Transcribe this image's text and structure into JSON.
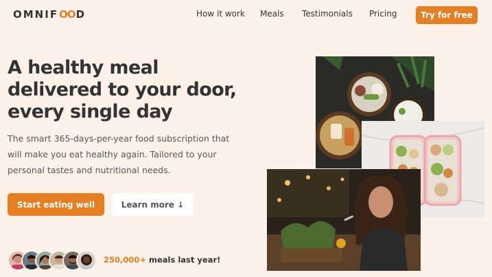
{
  "header": {
    "logo": {
      "prefix": "OMNIF",
      "oo": "OO",
      "suffix": "D"
    },
    "nav": [
      {
        "label": "How it work"
      },
      {
        "label": "Meals"
      },
      {
        "label": "Testimonials"
      },
      {
        "label": "Pricing"
      }
    ],
    "cta_label": "Try for free"
  },
  "hero": {
    "title_lines": [
      "A healthy meal",
      "delivered to your door,",
      "every single day"
    ],
    "description_lines": [
      "The smart 365-days-per-year food subscription that",
      "will make you eat healthy again. Tailored to your",
      "personal tastes and nutritional needs."
    ],
    "primary_button": "Start eating well",
    "secondary_button": "Learn more ↓"
  },
  "delivered": {
    "number": "250,000+",
    "text": " meals last year!"
  },
  "colors": {
    "accent": "#e67e22",
    "background": "#fdf2e9",
    "text": "#333333"
  },
  "images": {
    "bowls": "food-bowls-image",
    "boxes": "meal-prep-boxes-image",
    "woman": "woman-eating-image"
  }
}
